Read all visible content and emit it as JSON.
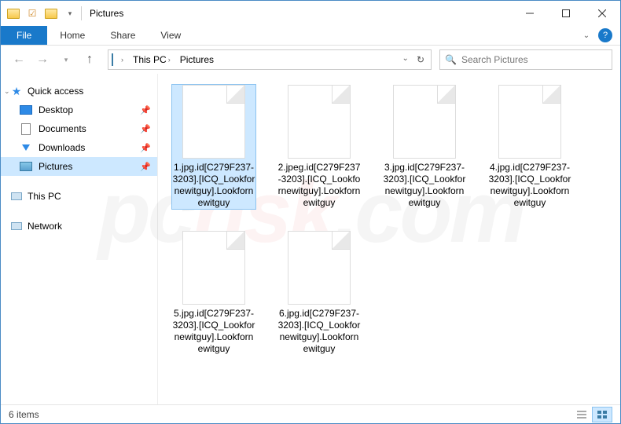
{
  "title": "Pictures",
  "ribbon": {
    "file": "File",
    "tabs": [
      "Home",
      "Share",
      "View"
    ]
  },
  "breadcrumb": [
    "This PC",
    "Pictures"
  ],
  "search_placeholder": "Search Pictures",
  "nav": {
    "quick_access": "Quick access",
    "items": [
      {
        "label": "Desktop"
      },
      {
        "label": "Documents"
      },
      {
        "label": "Downloads"
      },
      {
        "label": "Pictures"
      }
    ],
    "this_pc": "This PC",
    "network": "Network"
  },
  "files": [
    {
      "name": "1.jpg.id[C279F237-3203].[ICQ_Lookfornewitguy].Lookfornewitguy"
    },
    {
      "name": "2.jpeg.id[C279F237-3203].[ICQ_Lookfornewitguy].Lookfornewitguy"
    },
    {
      "name": "3.jpg.id[C279F237-3203].[ICQ_Lookfornewitguy].Lookfornewitguy"
    },
    {
      "name": "4.jpg.id[C279F237-3203].[ICQ_Lookfornewitguy].Lookfornewitguy"
    },
    {
      "name": "5.jpg.id[C279F237-3203].[ICQ_Lookfornewitguy].Lookfornewitguy"
    },
    {
      "name": "6.jpg.id[C279F237-3203].[ICQ_Lookfornewitguy].Lookfornewitguy"
    }
  ],
  "status": "6 items",
  "watermark": {
    "a": "pc",
    "b": "risk",
    "c": ".com"
  }
}
